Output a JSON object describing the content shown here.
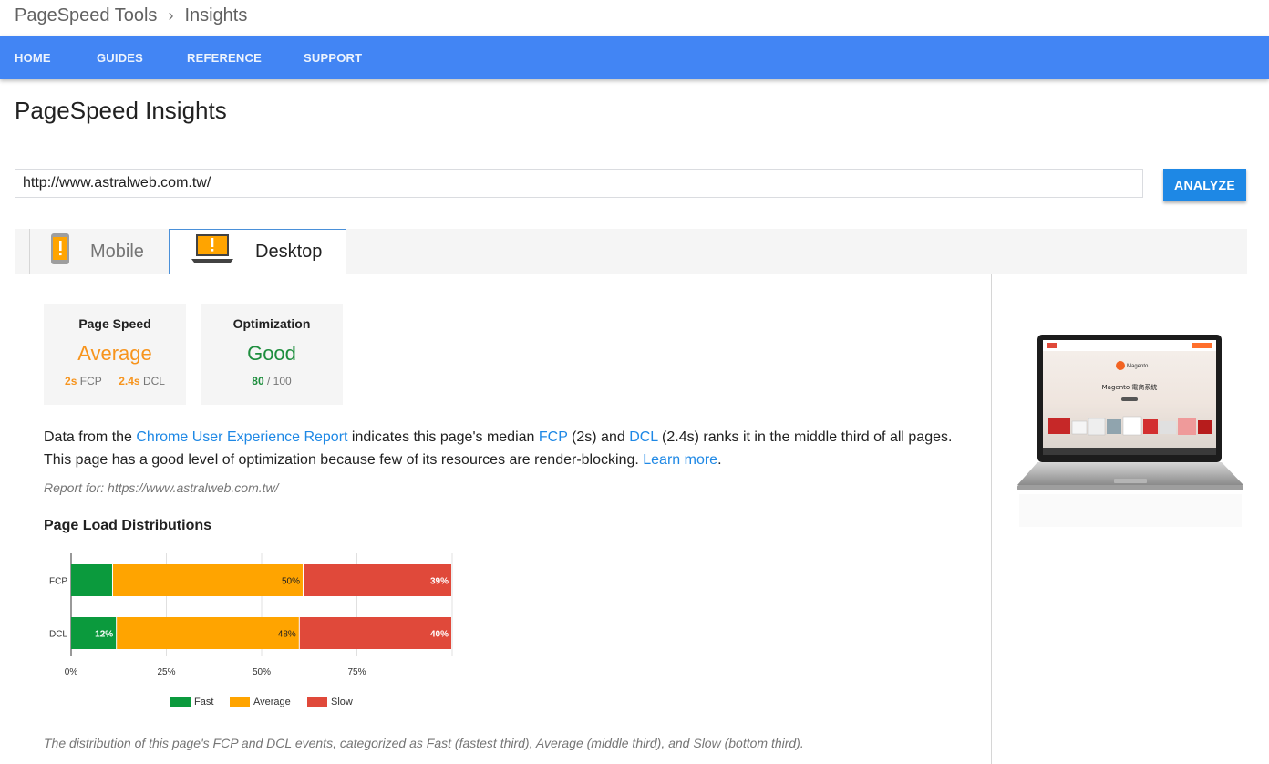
{
  "breadcrumb": {
    "root": "PageSpeed Tools",
    "separator": "›",
    "current": "Insights"
  },
  "nav": {
    "home": "HOME",
    "guides": "GUIDES",
    "reference": "REFERENCE",
    "support": "SUPPORT"
  },
  "page_title": "PageSpeed Insights",
  "url_input": {
    "value": "http://www.astralweb.com.tw/"
  },
  "analyze_label": "ANALYZE",
  "tabs": {
    "mobile": "Mobile",
    "desktop": "Desktop",
    "selected": "Desktop"
  },
  "cards": {
    "speed": {
      "label": "Page Speed",
      "value": "Average",
      "fcp_value": "2s",
      "fcp_label": "FCP",
      "dcl_value": "2.4s",
      "dcl_label": "DCL"
    },
    "optimization": {
      "label": "Optimization",
      "value": "Good",
      "score": "80",
      "out_of": "/ 100"
    }
  },
  "summary": {
    "part1": "Data from the ",
    "link1": "Chrome User Experience Report",
    "part2": " indicates this page's median ",
    "link2": "FCP",
    "part3": " (2s) and ",
    "link3": "DCL",
    "part4": " (2.4s) ranks it in the middle third of all pages. This page has a good level of optimization because few of its resources are render-blocking. ",
    "link4": "Learn more",
    "part5": "."
  },
  "report_for": "Report for: https://www.astralweb.com.tw/",
  "distribution_title": "Page Load Distributions",
  "caption": "The distribution of this page's FCP and DCL events, categorized as Fast (fastest third), Average (middle third), and Slow (bottom third).",
  "colors": {
    "fast": "#0b9a3d",
    "average": "#ffa400",
    "slow": "#e0493a",
    "accent": "#4285f4"
  },
  "chart_data": {
    "type": "bar",
    "orientation": "horizontal",
    "stacked": true,
    "categories": [
      "FCP",
      "DCL"
    ],
    "series": [
      {
        "name": "Fast",
        "values": [
          11,
          12
        ],
        "labels": [
          "",
          "12%"
        ]
      },
      {
        "name": "Average",
        "values": [
          50,
          48
        ],
        "labels": [
          "50%",
          "48%"
        ]
      },
      {
        "name": "Slow",
        "values": [
          39,
          40
        ],
        "labels": [
          "39%",
          "40%"
        ]
      }
    ],
    "x_ticks": [
      "0%",
      "25%",
      "50%",
      "75%"
    ],
    "xlim": [
      0,
      100
    ],
    "grid": true,
    "legend": "bottom"
  },
  "preview": {
    "site_heading": "Magento 電商系統",
    "brand": "Magento"
  }
}
